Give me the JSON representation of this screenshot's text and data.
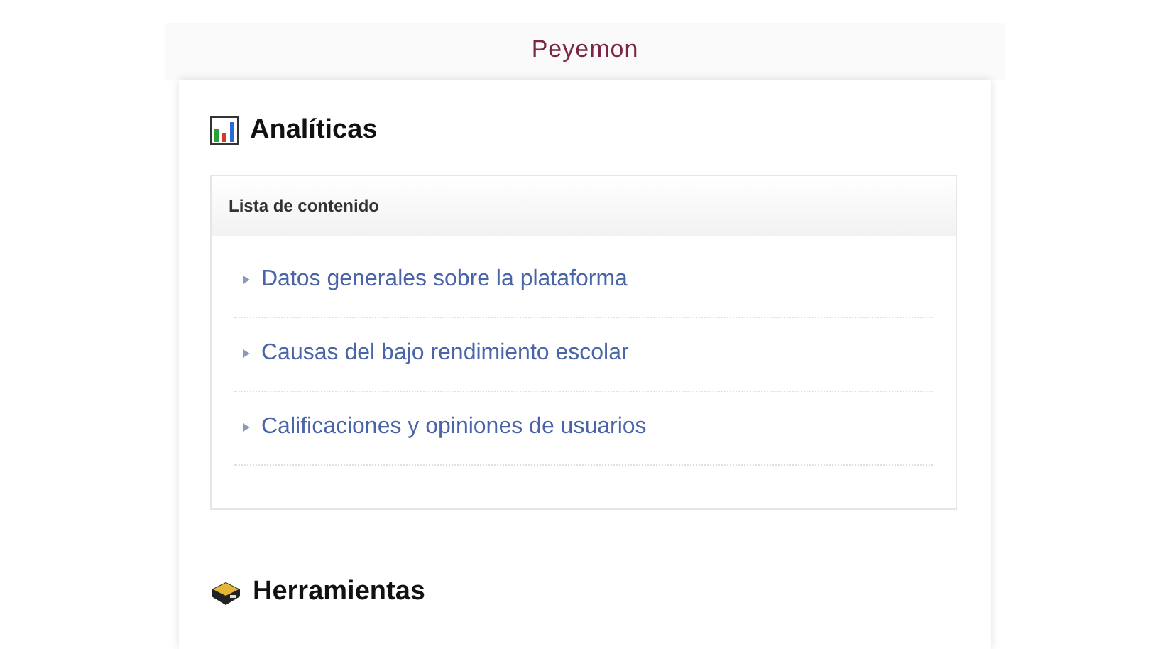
{
  "site": {
    "title": "Peyemon"
  },
  "sections": [
    {
      "kind": "chart",
      "heading": "Analíticas",
      "toc": {
        "title": "Lista de contenido",
        "items": [
          "Datos generales sobre la plataforma",
          "Causas del bajo rendimiento escolar",
          "Calificaciones y opiniones de usuarios"
        ]
      }
    },
    {
      "kind": "toolbox",
      "heading": "Herramientas"
    }
  ]
}
